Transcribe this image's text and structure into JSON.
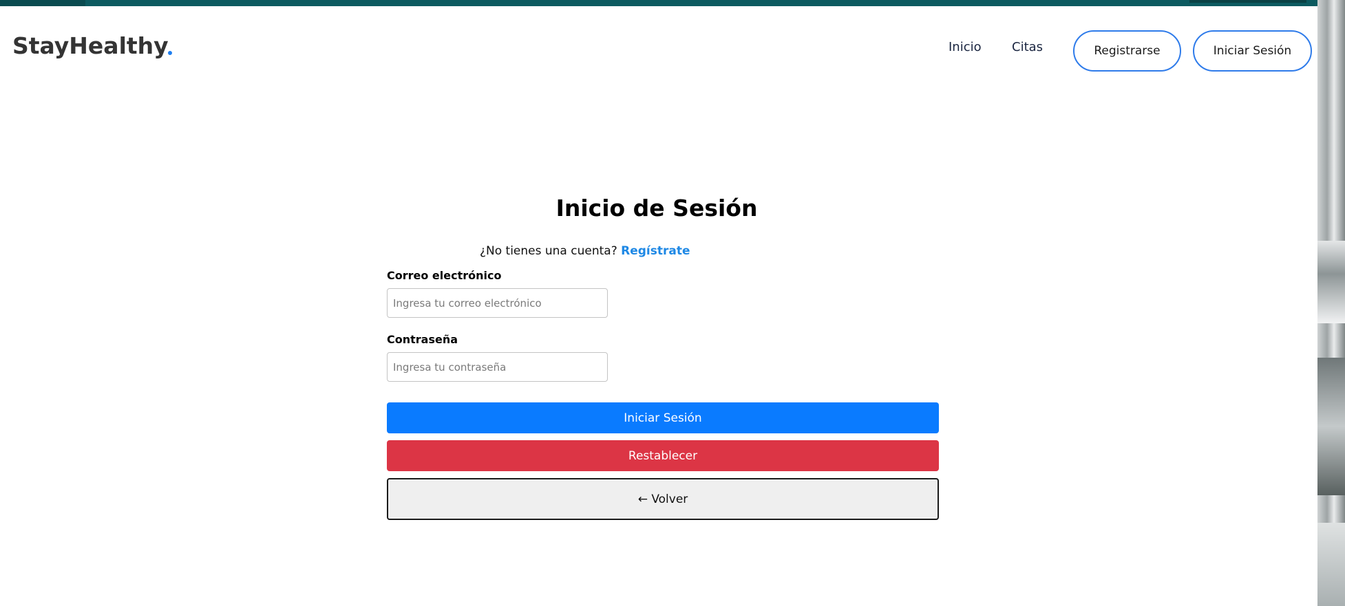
{
  "header": {
    "brand": "StayHealthy",
    "nav": [
      {
        "label": "Inicio"
      },
      {
        "label": "Citas"
      }
    ],
    "register_button": "Registrarse",
    "login_button": "Iniciar Sesión"
  },
  "login": {
    "title": "Inicio de Sesión",
    "signup_prompt": "¿No tienes una cuenta?",
    "signup_link": "Regístrate",
    "email": {
      "label": "Correo electrónico",
      "placeholder": "Ingresa tu correo electrónico",
      "value": ""
    },
    "password": {
      "label": "Contraseña",
      "placeholder": "Ingresa tu contraseña",
      "value": ""
    },
    "submit_button": "Iniciar Sesión",
    "reset_button": "Restablecer",
    "back_button": "← Volver"
  },
  "colors": {
    "accent": "#0a7bff",
    "danger": "#dc3545",
    "topbar": "#0c5a60",
    "nav_border": "#2e7bea",
    "link": "#1e88e5"
  }
}
